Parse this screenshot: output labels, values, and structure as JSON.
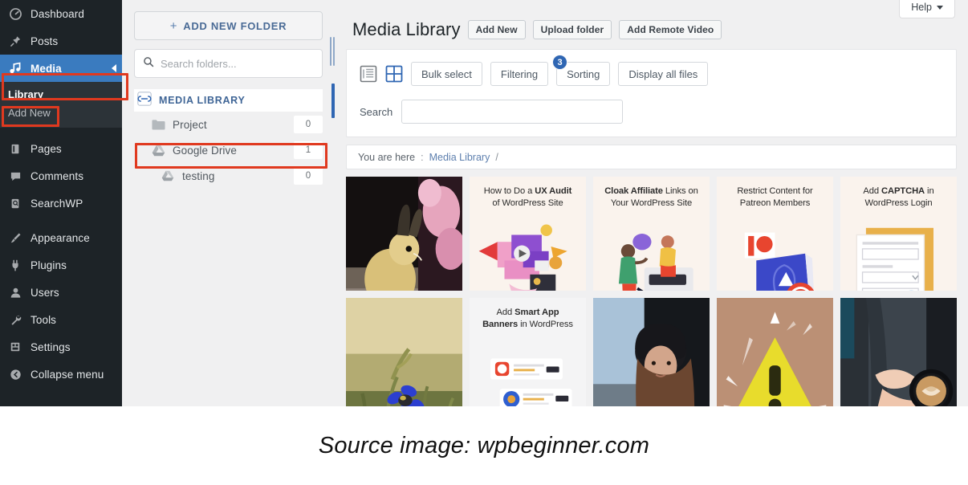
{
  "sidebar": {
    "items": [
      {
        "label": "Dashboard",
        "icon": "dashboard-icon",
        "active": false
      },
      {
        "label": "Posts",
        "icon": "pin-icon",
        "active": false
      },
      {
        "label": "Media",
        "icon": "media-icon",
        "active": true
      },
      {
        "label": "Pages",
        "icon": "pages-icon",
        "active": false
      },
      {
        "label": "Comments",
        "icon": "comments-icon",
        "active": false
      },
      {
        "label": "SearchWP",
        "icon": "searchwp-icon",
        "active": false
      },
      {
        "label": "Appearance",
        "icon": "brush-icon",
        "active": false
      },
      {
        "label": "Plugins",
        "icon": "plug-icon",
        "active": false
      },
      {
        "label": "Users",
        "icon": "users-icon",
        "active": false
      },
      {
        "label": "Tools",
        "icon": "wrench-icon",
        "active": false
      },
      {
        "label": "Settings",
        "icon": "settings-icon",
        "active": false
      },
      {
        "label": "Collapse menu",
        "icon": "collapse-icon",
        "active": false
      }
    ],
    "submenu": [
      {
        "label": "Library",
        "current": true
      },
      {
        "label": "Add New",
        "current": false
      }
    ],
    "active_color": "#3a7bbf",
    "background": "#1d2327"
  },
  "folders": {
    "add_folder_label": "ADD NEW FOLDER",
    "add_folder_plus": "+",
    "search_placeholder": "Search folders...",
    "search_value": "",
    "tree_header": "MEDIA LIBRARY",
    "tree_header_icon": "folders-link-icon",
    "rows": [
      {
        "name": "Project",
        "count": "0",
        "icon": "folder-icon",
        "level": 1,
        "highlighted": false
      },
      {
        "name": "Google Drive",
        "count": "1",
        "icon": "google-drive-icon",
        "level": 1,
        "highlighted": true
      },
      {
        "name": "testing",
        "count": "0",
        "icon": "google-drive-icon",
        "level": 2,
        "highlighted": false
      }
    ]
  },
  "main": {
    "help_label": "Help",
    "page_title": "Media Library",
    "title_buttons": [
      {
        "label": "Add New"
      },
      {
        "label": "Upload folder"
      },
      {
        "label": "Add Remote Video"
      }
    ],
    "toolbar": {
      "list_view_icon": "list-view-icon",
      "grid_view_icon": "grid-view-icon",
      "buttons": [
        {
          "label": "Bulk select"
        },
        {
          "label": "Filtering"
        },
        {
          "label": "Sorting"
        },
        {
          "label": "Display all files"
        }
      ],
      "filter_badge_count": "3",
      "badge_color": "#2f66b3"
    },
    "search": {
      "label": "Search",
      "value": "",
      "placeholder": ""
    },
    "breadcrumb": {
      "prefix": "You are here",
      "separator": ":",
      "link": "Media Library",
      "trailing": "/"
    }
  },
  "media_grid": {
    "items": [
      {
        "type": "photo",
        "kind": "rabbit-photo",
        "title": ""
      },
      {
        "type": "card",
        "kind": "ux-audit-card",
        "line1_plain": "How to Do a ",
        "line1_bold": "UX Audit",
        "line2_plain": "of WordPress Site",
        "line2_bold": ""
      },
      {
        "type": "card",
        "kind": "cloak-affiliate-card",
        "line1_plain": "Links on",
        "line1_bold": "Cloak Affiliate",
        "line2_plain": "Your WordPress Site",
        "line2_bold": ""
      },
      {
        "type": "card",
        "kind": "patreon-restrict-card",
        "line1_plain": "Restrict Content for",
        "line1_bold": "",
        "line2_plain": "Patreon Members",
        "line2_bold": ""
      },
      {
        "type": "card",
        "kind": "captcha-login-card",
        "line1_plain": "Add ",
        "line1_bold": "CAPTCHA",
        "line1_suffix": " in",
        "line2_plain": "WordPress Login",
        "line2_bold": ""
      },
      {
        "type": "photo",
        "kind": "cornflower-photo",
        "title": ""
      },
      {
        "type": "card",
        "kind": "smart-app-banners-card",
        "line1_plain": "Add ",
        "line1_bold": "Smart App",
        "line2_plain": " in WordPress",
        "line2_bold": "Banners"
      },
      {
        "type": "photo",
        "kind": "woman-beanie-photo",
        "title": ""
      },
      {
        "type": "photo",
        "kind": "warning-sign-photo",
        "title": ""
      },
      {
        "type": "photo",
        "kind": "coffee-cup-photo",
        "title": ""
      }
    ]
  },
  "annotations": {
    "color": "#e0391f",
    "boxes": [
      {
        "name": "media-menu-highlight"
      },
      {
        "name": "library-submenu-highlight"
      },
      {
        "name": "google-drive-folder-highlight"
      }
    ]
  },
  "caption": {
    "text": "Source image: wpbeginner.com"
  }
}
